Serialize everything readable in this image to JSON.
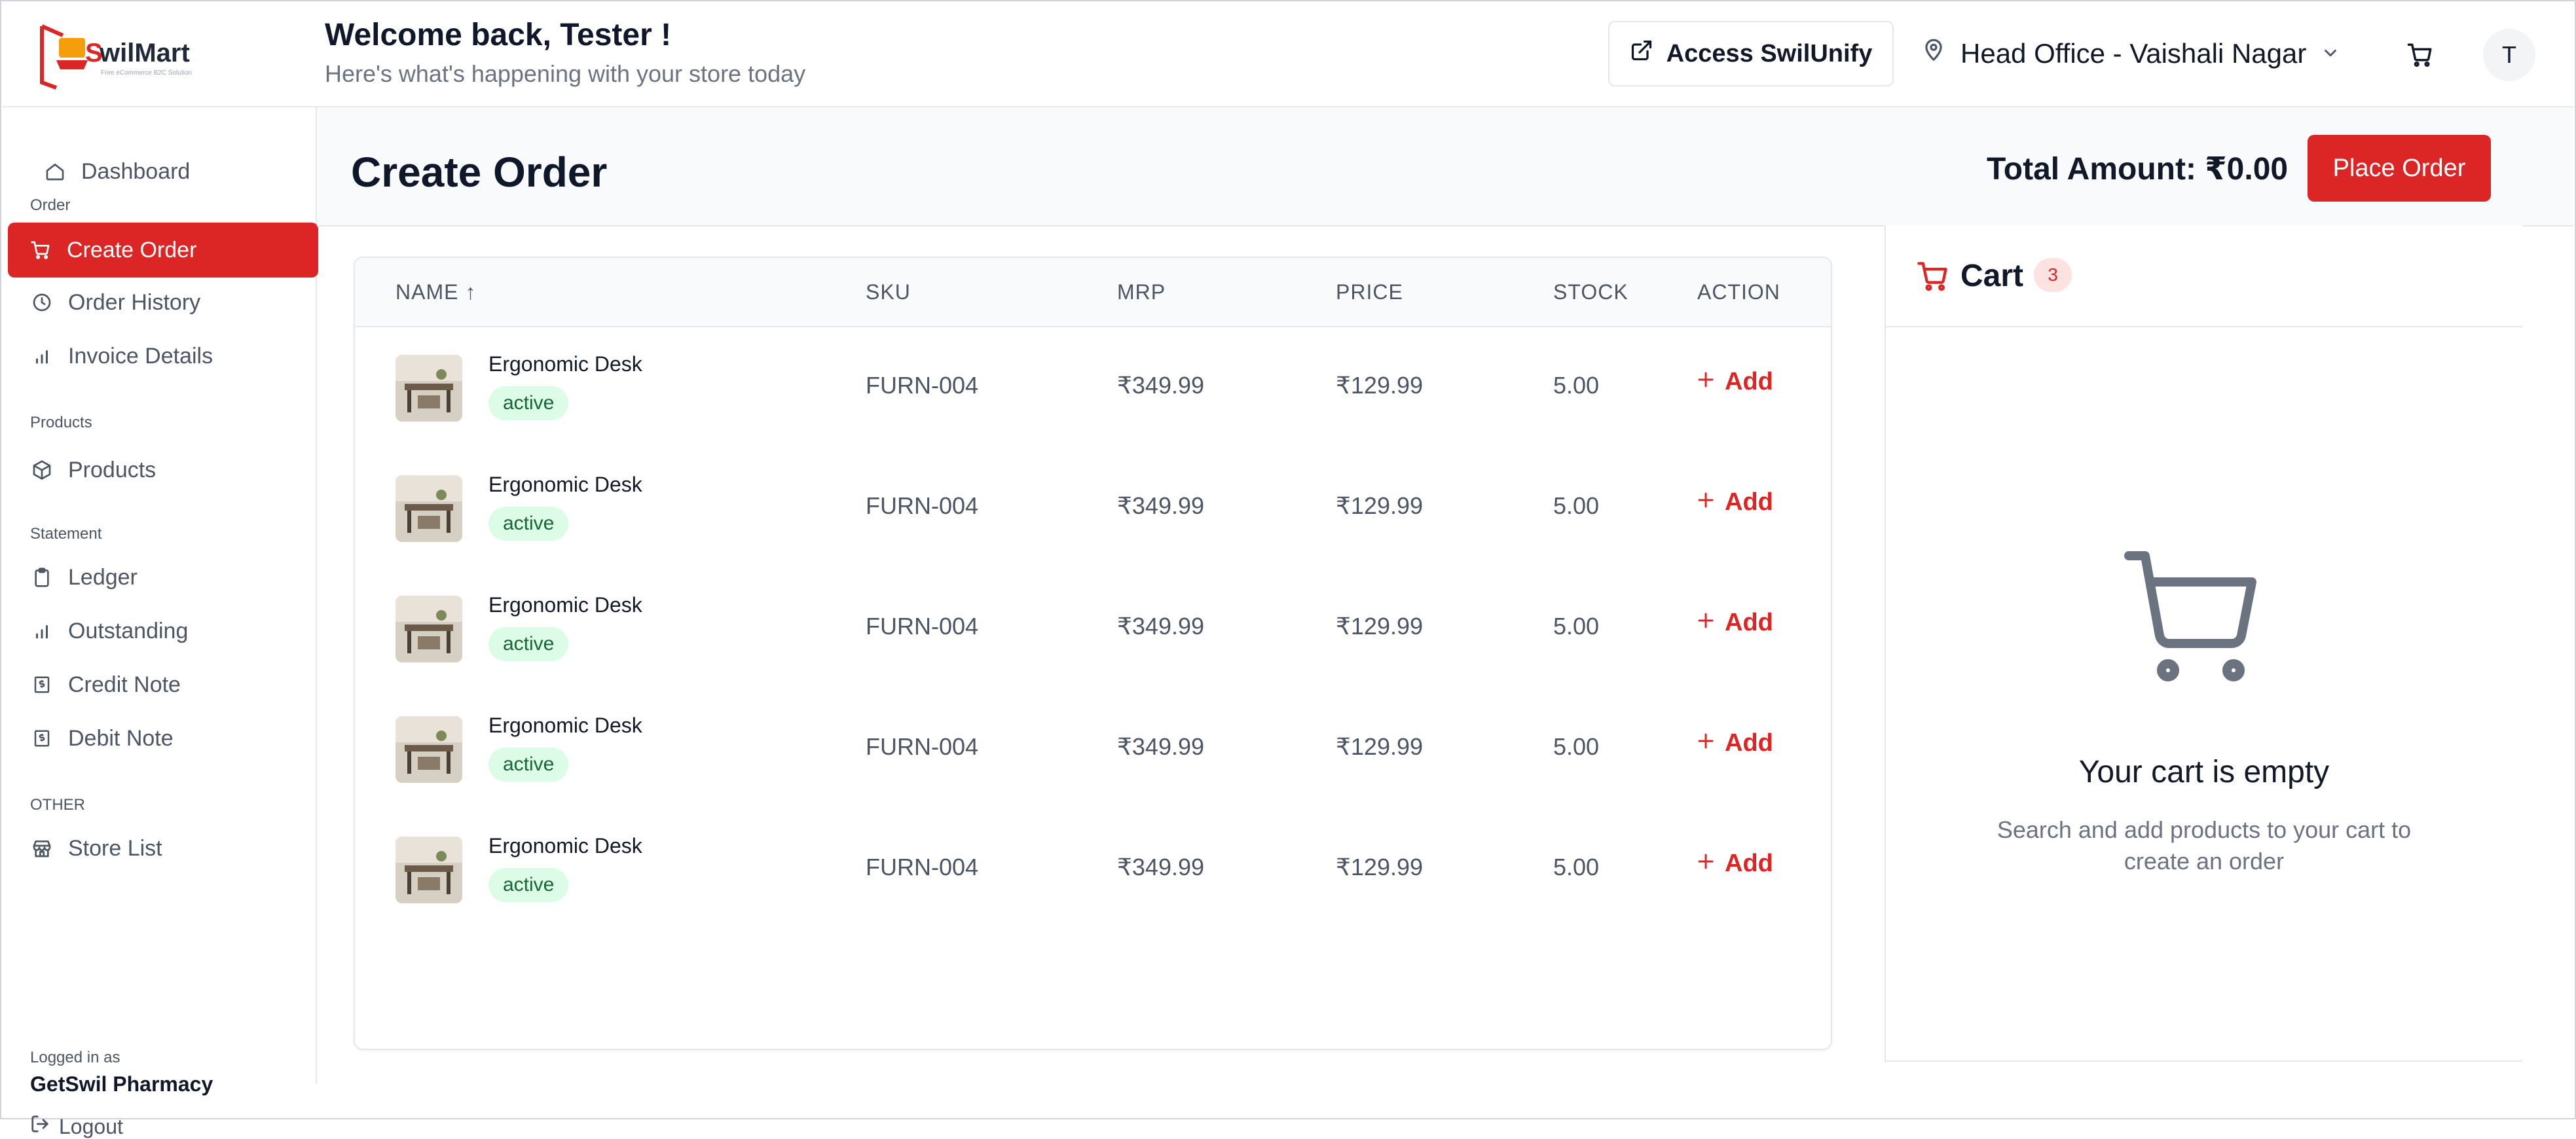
{
  "header": {
    "logo_text": "SwilMart",
    "logo_tagline": "Free eCommerce B2C Solution",
    "welcome": "Welcome back, Tester !",
    "subtitle": "Here's what's happening with your store today",
    "access_button": "Access SwilUnify",
    "location": "Head Office - Vaishali Nagar",
    "avatar_initial": "T"
  },
  "sidebar": {
    "dashboard": "Dashboard",
    "section_order": "Order",
    "create_order": "Create Order",
    "order_history": "Order History",
    "invoice_details": "Invoice Details",
    "section_products": "Products",
    "products": "Products",
    "section_statement": "Statement",
    "ledger": "Ledger",
    "outstanding": "Outstanding",
    "credit_note": "Credit Note",
    "debit_note": "Debit Note",
    "section_other": "OTHER",
    "store_list": "Store List",
    "logged_in_label": "Logged in as",
    "logged_in_name": "GetSwil Pharmacy",
    "logout": "Logout"
  },
  "page": {
    "title": "Create Order",
    "total_amount": "Total Amount: ₹0.00",
    "place_order": "Place Order"
  },
  "table": {
    "headers": [
      "NAME ↑",
      "SKU",
      "MRP",
      "PRICE",
      "STOCK",
      "ACTION"
    ],
    "add_label": "Add",
    "rows": [
      {
        "name": "Ergonomic Desk",
        "status": "active",
        "sku": "FURN-004",
        "mrp": "₹349.99",
        "price": "₹129.99",
        "stock": "5.00"
      },
      {
        "name": "Ergonomic Desk",
        "status": "active",
        "sku": "FURN-004",
        "mrp": "₹349.99",
        "price": "₹129.99",
        "stock": "5.00"
      },
      {
        "name": "Ergonomic Desk",
        "status": "active",
        "sku": "FURN-004",
        "mrp": "₹349.99",
        "price": "₹129.99",
        "stock": "5.00"
      },
      {
        "name": "Ergonomic Desk",
        "status": "active",
        "sku": "FURN-004",
        "mrp": "₹349.99",
        "price": "₹129.99",
        "stock": "5.00"
      },
      {
        "name": "Ergonomic Desk",
        "status": "active",
        "sku": "FURN-004",
        "mrp": "₹349.99",
        "price": "₹129.99",
        "stock": "5.00"
      }
    ]
  },
  "cart": {
    "title": "Cart",
    "count": "3",
    "empty_title": "Your cart is empty",
    "empty_subtitle": "Search and add products to your cart to create an order"
  },
  "colors": {
    "accent": "#dc2626",
    "badge_bg": "#dcfce7",
    "badge_text": "#166534"
  }
}
